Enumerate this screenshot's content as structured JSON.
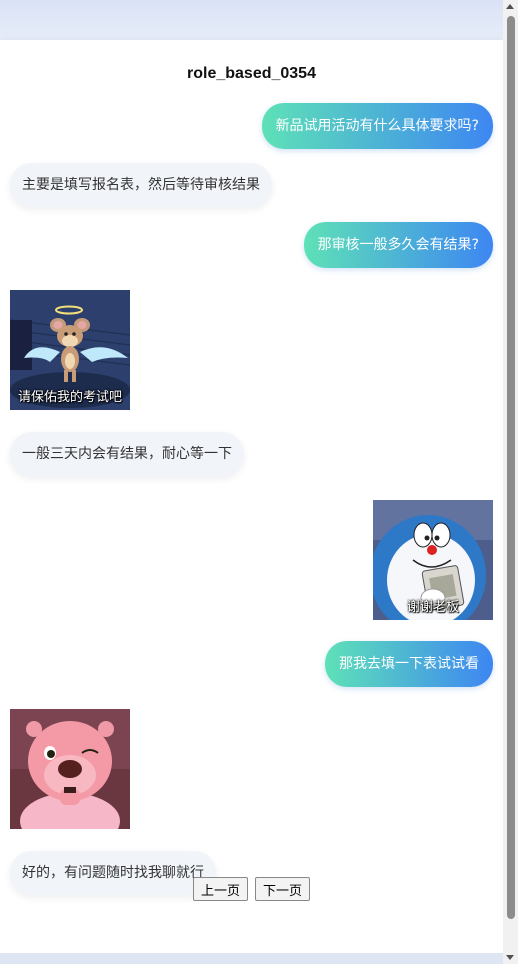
{
  "chat": {
    "title": "role_based_0354",
    "messages": [
      {
        "side": "out",
        "text": "新品试用活动有什么具体要求吗?"
      },
      {
        "side": "in",
        "text": "主要是填写报名表，然后等待审核结果"
      },
      {
        "side": "out",
        "text": "那审核一般多久会有结果?"
      },
      {
        "side": "in",
        "sticker": "angel-mouse",
        "caption": "请保佑我的考试吧"
      },
      {
        "side": "in",
        "text": "一般三天内会有结果，耐心等一下"
      },
      {
        "side": "out",
        "sticker": "cat-robot",
        "caption": "谢谢老板"
      },
      {
        "side": "out",
        "text": "那我去填一下表试试看"
      },
      {
        "side": "in",
        "sticker": "pink-beaver-wink"
      },
      {
        "side": "in",
        "text": "好的，有问题随时找我聊就行"
      }
    ]
  },
  "pager": {
    "prev_label": "上一页",
    "next_label": "下一页"
  }
}
